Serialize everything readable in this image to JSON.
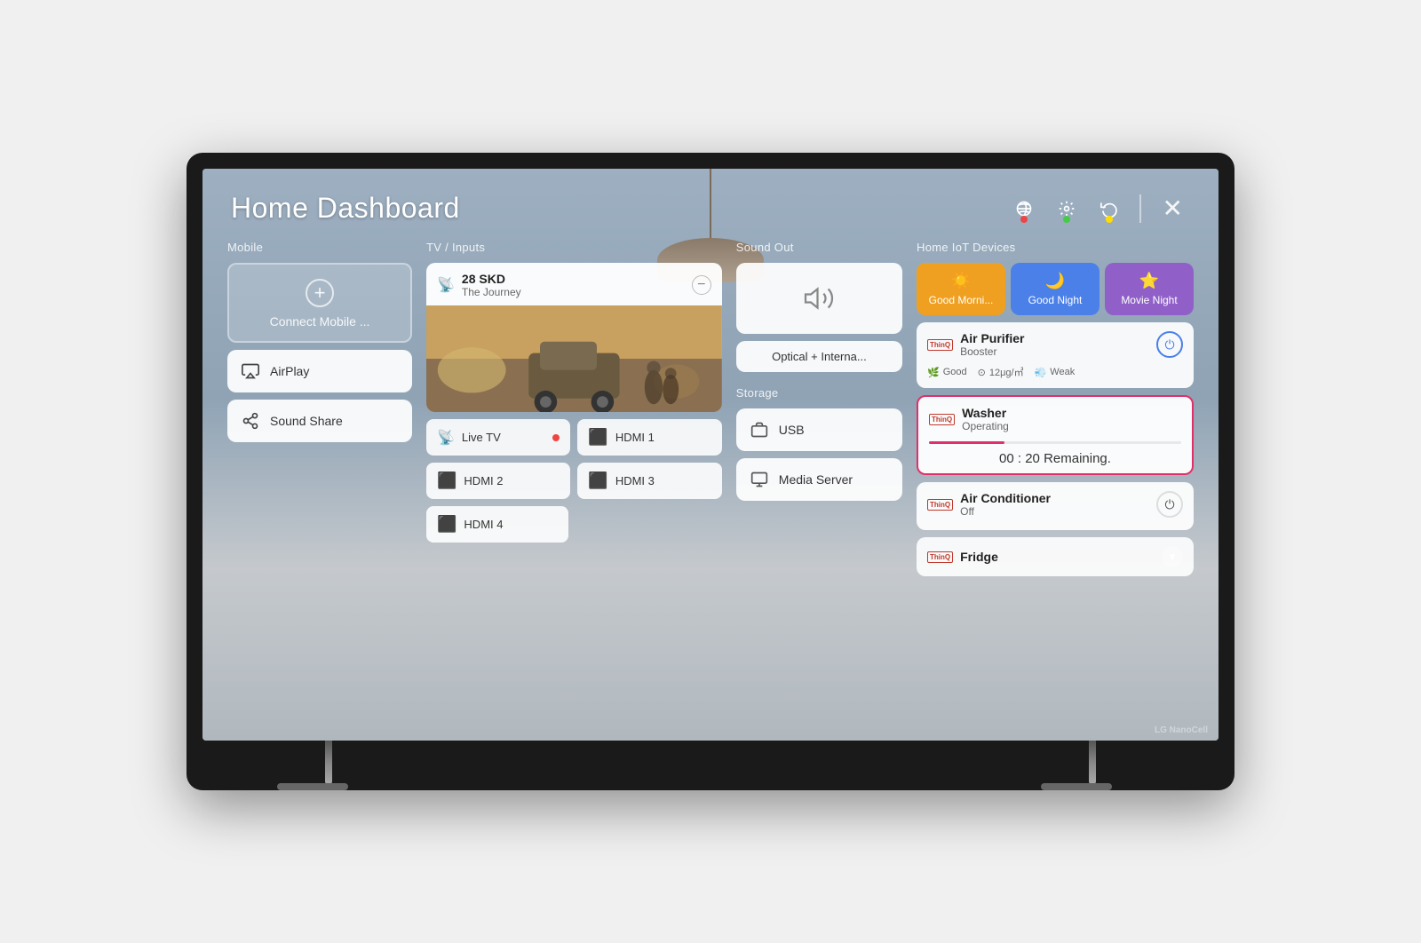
{
  "dashboard": {
    "title": "Home Dashboard",
    "controls": {
      "network_label": "network-icon",
      "settings_label": "settings-icon",
      "refresh_label": "refresh-icon",
      "close_label": "✕"
    },
    "columns": {
      "mobile": {
        "header": "Mobile",
        "connect_label": "Connect Mobile ...",
        "airplay_label": "AirPlay",
        "sound_share_label": "Sound Share"
      },
      "tv_inputs": {
        "header": "TV / Inputs",
        "live_channel": "28 SKD",
        "live_show": "The Journey",
        "live_label": "Live TV",
        "hdmi1": "HDMI 1",
        "hdmi2": "HDMI 2",
        "hdmi3": "HDMI 3",
        "hdmi4": "HDMI 4"
      },
      "sound_out": {
        "header": "Sound Out",
        "label": "Optical + Interna..."
      },
      "storage": {
        "header": "Storage",
        "usb_label": "USB",
        "media_server_label": "Media Server"
      },
      "home_iot": {
        "header": "Home IoT Devices",
        "scenes": {
          "morning_label": "Good Morni...",
          "night_label": "Good Night",
          "movie_label": "Movie Night"
        },
        "air_purifier": {
          "name": "Air Purifier",
          "mode": "Booster",
          "stat1": "Good",
          "stat2": "12μg/㎥",
          "stat3": "Weak"
        },
        "washer": {
          "name": "Washer",
          "status": "Operating",
          "time": "00 : 20 Remaining."
        },
        "air_conditioner": {
          "name": "Air Conditioner",
          "status": "Off"
        },
        "fridge": {
          "name": "Fridge"
        }
      }
    }
  }
}
